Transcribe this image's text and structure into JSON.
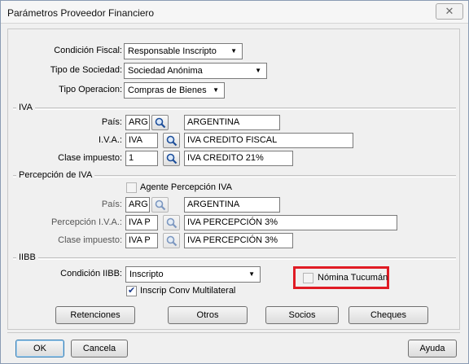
{
  "window": {
    "title": "Parámetros Proveedor Financiero",
    "close_icon": "✕"
  },
  "top": {
    "condicion_fiscal": {
      "label": "Condición Fiscal:",
      "value": "Responsable Inscripto"
    },
    "tipo_sociedad": {
      "label": "Tipo de Sociedad:",
      "value": "Sociedad Anónima"
    },
    "tipo_operacion": {
      "label": "Tipo Operacion:",
      "value": "Compras de Bienes"
    }
  },
  "iva": {
    "caption": "IVA",
    "pais": {
      "label": "País:",
      "code": "ARG",
      "name": "ARGENTINA"
    },
    "iva_field": {
      "label": "I.V.A.:",
      "code": "IVA",
      "name": "IVA  CREDITO FISCAL"
    },
    "clase": {
      "label": "Clase impuesto:",
      "code": "1",
      "name": "IVA CREDITO 21%"
    }
  },
  "percepcion": {
    "caption": "Percepción de IVA",
    "agente_label": "Agente Percepción IVA",
    "agente_checked": false,
    "pais": {
      "label": "País:",
      "code": "ARG",
      "name": "ARGENTINA"
    },
    "perc_iva": {
      "label": "Percepción I.V.A.:",
      "code": "IVA P",
      "name": "IVA PERCEPCIÓN 3%"
    },
    "clase": {
      "label": "Clase impuesto:",
      "code": "IVA P",
      "name": "IVA PERCEPCIÓN   3%"
    }
  },
  "iibb": {
    "caption": "IIBB",
    "condicion": {
      "label": "Condición IIBB:",
      "value": "Inscripto"
    },
    "conv_label": "Inscrip Conv Multilateral",
    "conv_checked": true,
    "nomina_label": "Nómina Tucumán",
    "nomina_checked": false,
    "highlight_color": "#e01b24"
  },
  "actions": {
    "retenciones": "Retenciones",
    "otros": "Otros",
    "socios": "Socios",
    "cheques": "Cheques"
  },
  "footer": {
    "ok": "OK",
    "cancel": "Cancela",
    "help": "Ayuda"
  },
  "icons": {
    "search": "search-icon",
    "dropdown": "chevron-down-icon"
  }
}
